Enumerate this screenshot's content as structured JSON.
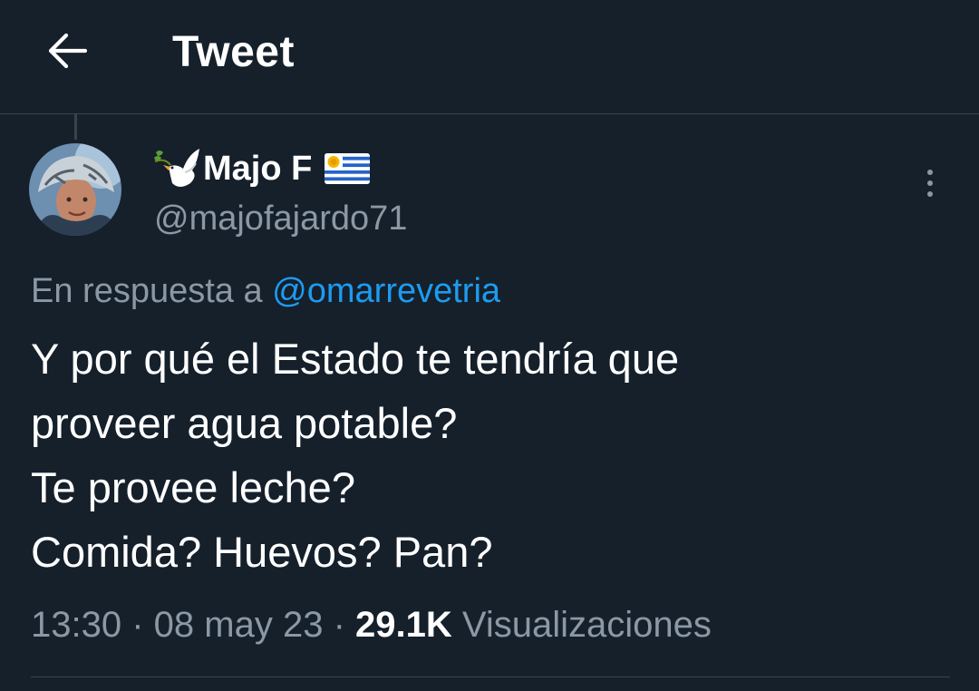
{
  "header": {
    "title": "Tweet",
    "back_icon": "arrow-left-icon"
  },
  "author": {
    "name": "Majo F",
    "handle": "@majofajardo71",
    "name_prefix_emoji": "dove-with-olive-branch",
    "name_suffix_emoji": "uruguay-flag"
  },
  "tweet": {
    "reply_prefix": "En respuesta a",
    "reply_to": "@omarrevetria",
    "lines": [
      "Y por qué el Estado te tendría que",
      "proveer agua potable?",
      "Te provee leche?",
      "Comida? Huevos? Pan?"
    ],
    "time": "13:30",
    "date": "08 may 23",
    "views_count": "29.1K",
    "views_label": "Visualizaciones"
  },
  "colors": {
    "background": "#15202b",
    "text": "#ffffff",
    "secondary": "#8b98a5",
    "link": "#1d9bf0",
    "divider": "#38444d"
  }
}
